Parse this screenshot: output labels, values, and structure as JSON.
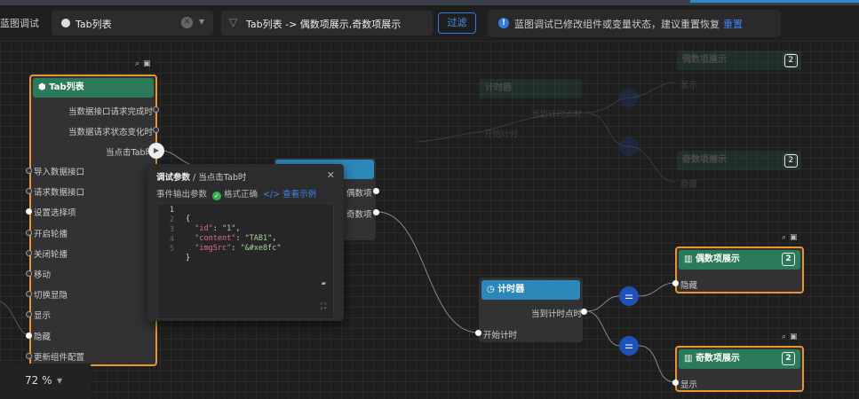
{
  "toolbar": {
    "title": "蓝图调试",
    "select_value": "Tab列表",
    "filter_text": "Tab列表 -> 偶数项展示,奇数项展示",
    "filter_button": "过滤",
    "notice": "蓝图调试已修改组件或变量状态，建议重置恢复",
    "notice_link": "重置"
  },
  "tab_node": {
    "title": "Tab列表",
    "outputs": [
      "当数据接口请求完成时",
      "当数据请求状态变化时",
      "当点击Tab时"
    ],
    "inputs": [
      "导入数据接口",
      "请求数据接口",
      "设置选择项",
      "开启轮播",
      "关闭轮播",
      "移动",
      "切换显隐",
      "显示",
      "隐藏",
      "更新组件配置"
    ]
  },
  "branch_node": {
    "outputs": [
      "偶数项",
      "奇数项"
    ]
  },
  "popover": {
    "title": "调试参数",
    "subtitle": "当点击Tab时",
    "row_label": "事件输出参数",
    "status": "格式正确",
    "example_link": "查看示例",
    "line_numbers": [
      "1",
      "2",
      "3",
      "4",
      "5"
    ],
    "code": {
      "open": "{",
      "id_key": "\"id\"",
      "id_val": "\"1\"",
      "content_key": "\"content\"",
      "content_val": "\"TAB1\"",
      "img_key": "\"imgSrc\"",
      "img_val": "\"&#xe8fc\"",
      "close": "}"
    }
  },
  "timer_node": {
    "title": "计时器",
    "output": "当到计时点时",
    "input": "开始计时"
  },
  "even_node": {
    "title": "偶数项展示",
    "badge": "2",
    "input": "隐藏"
  },
  "odd_node": {
    "title": "奇数项展示",
    "badge": "2",
    "input": "显示"
  },
  "ghost": {
    "timer_title": "计时器",
    "timer_output": "当到计时点时",
    "timer_input": "开始计时",
    "even_title": "偶数项展示",
    "even_badge": "2",
    "even_input": "显示",
    "odd_title": "奇数项展示",
    "odd_badge": "2",
    "odd_input": "隐藏"
  },
  "zoom": {
    "value": "72 %"
  }
}
